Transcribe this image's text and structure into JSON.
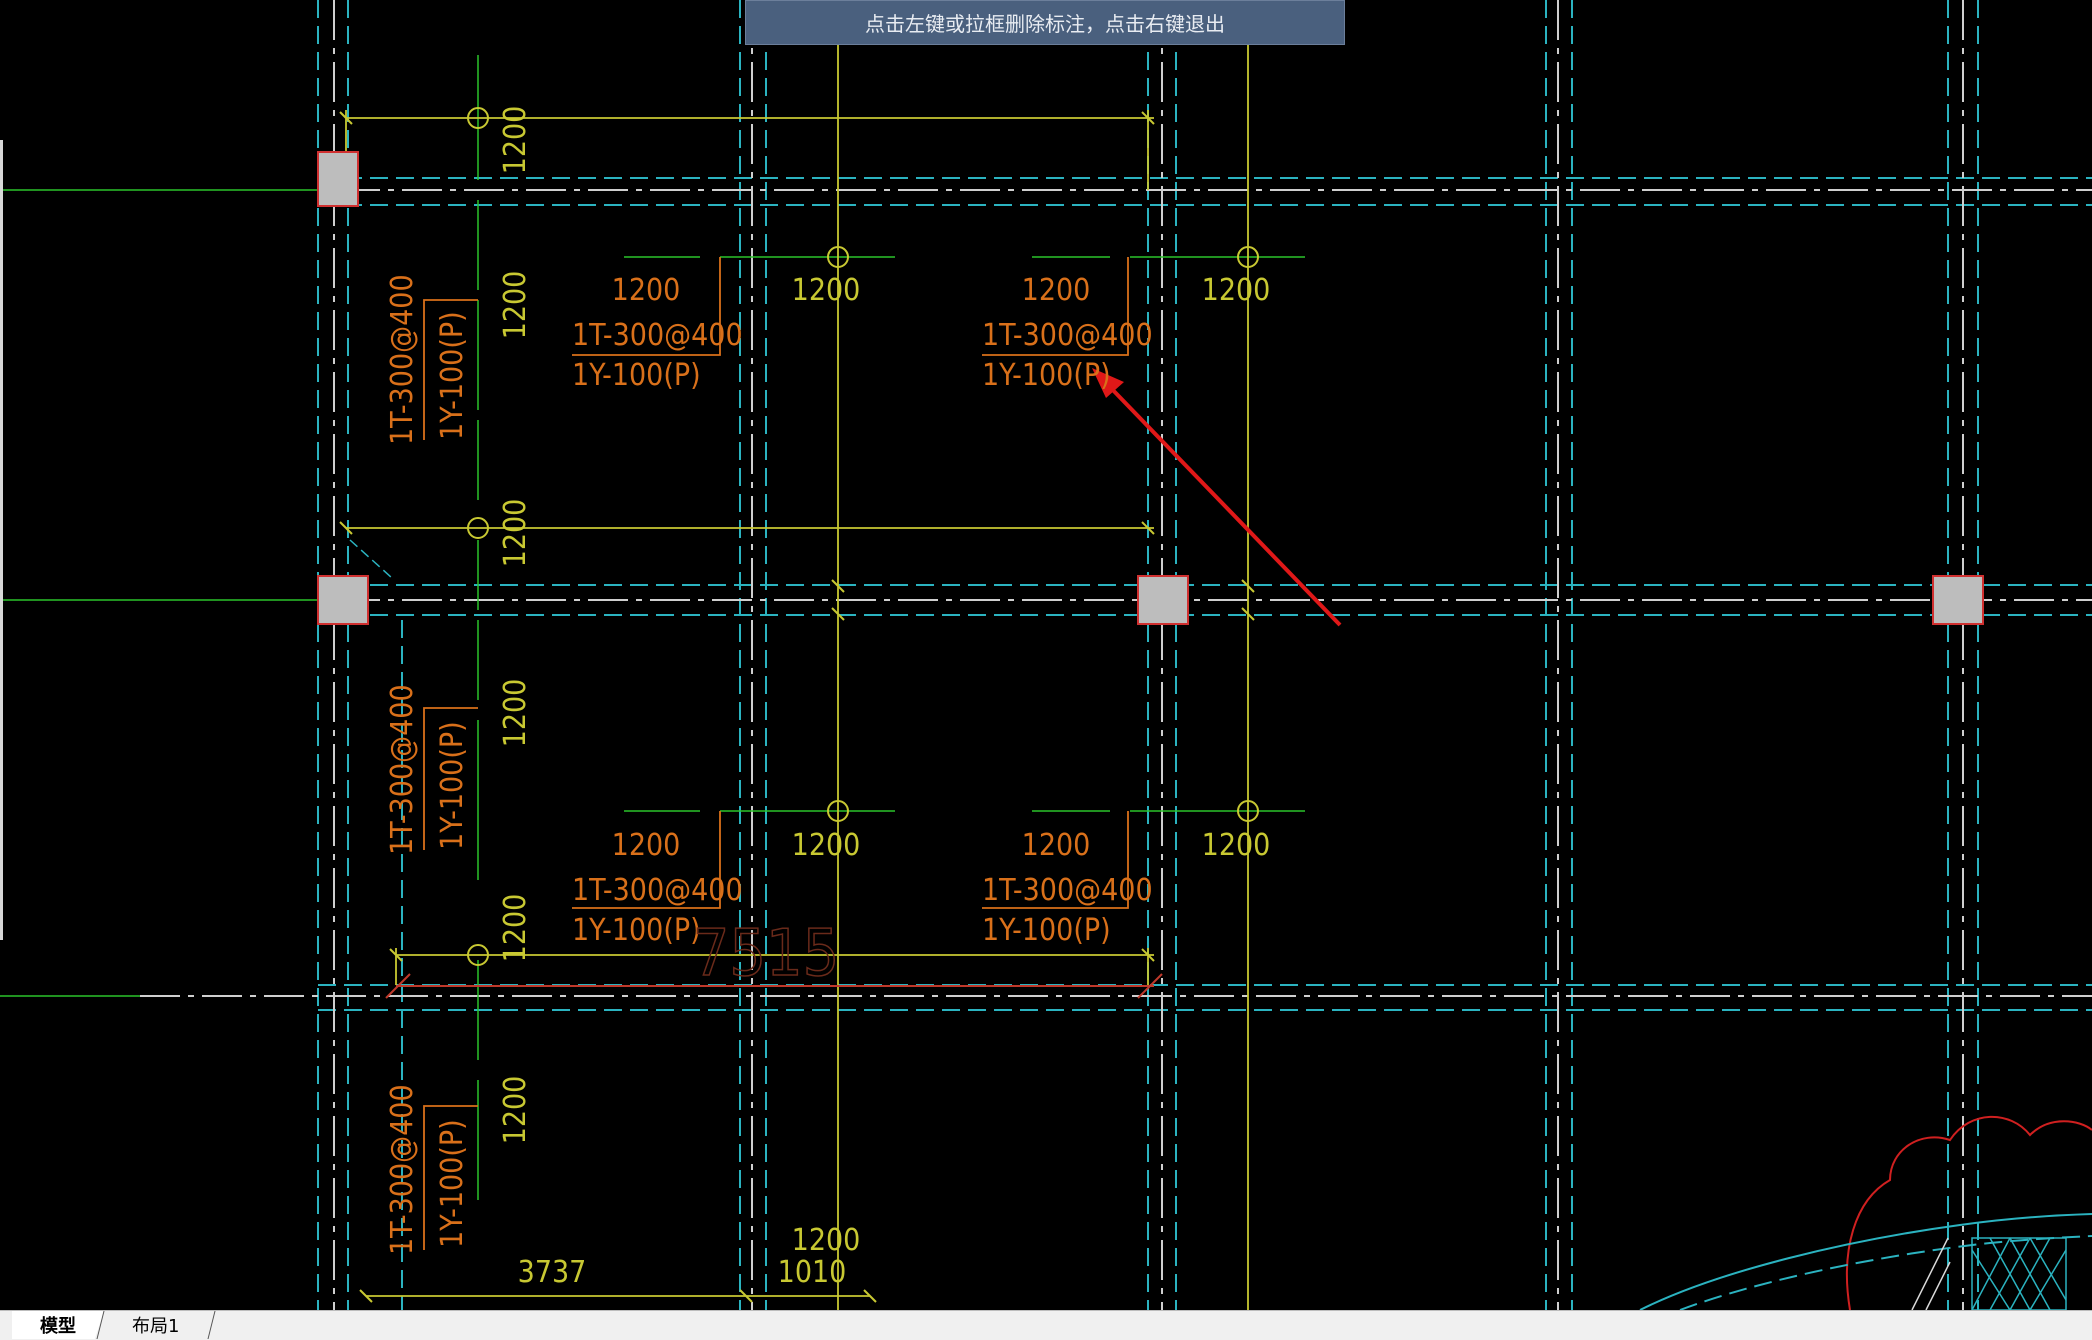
{
  "prompt": {
    "text": "点击左键或拉框删除标注，点击右键退出"
  },
  "tabs": [
    {
      "label": "模型",
      "active": true
    },
    {
      "label": "布局1",
      "active": false
    }
  ],
  "colors": {
    "background": "#000000",
    "cyan_lines": "#2bb3c0",
    "white_lines": "#d9d9d9",
    "green_lines": "#2ac42a",
    "yellow_lines": "#c8c832",
    "orange_text": "#d9701a",
    "red_arrow": "#e01818",
    "column_fill": "#c0c0c0",
    "column_border": "#d03030",
    "prompt_bg": "#4a607e"
  },
  "drawing": {
    "dim_labels_1200": "1200",
    "rebar_top": "1T-300@400",
    "rebar_bottom": "1Y-100(P)",
    "span_label": "7515",
    "bottom_dim_1": "3737",
    "bottom_dim_2": "1010"
  }
}
